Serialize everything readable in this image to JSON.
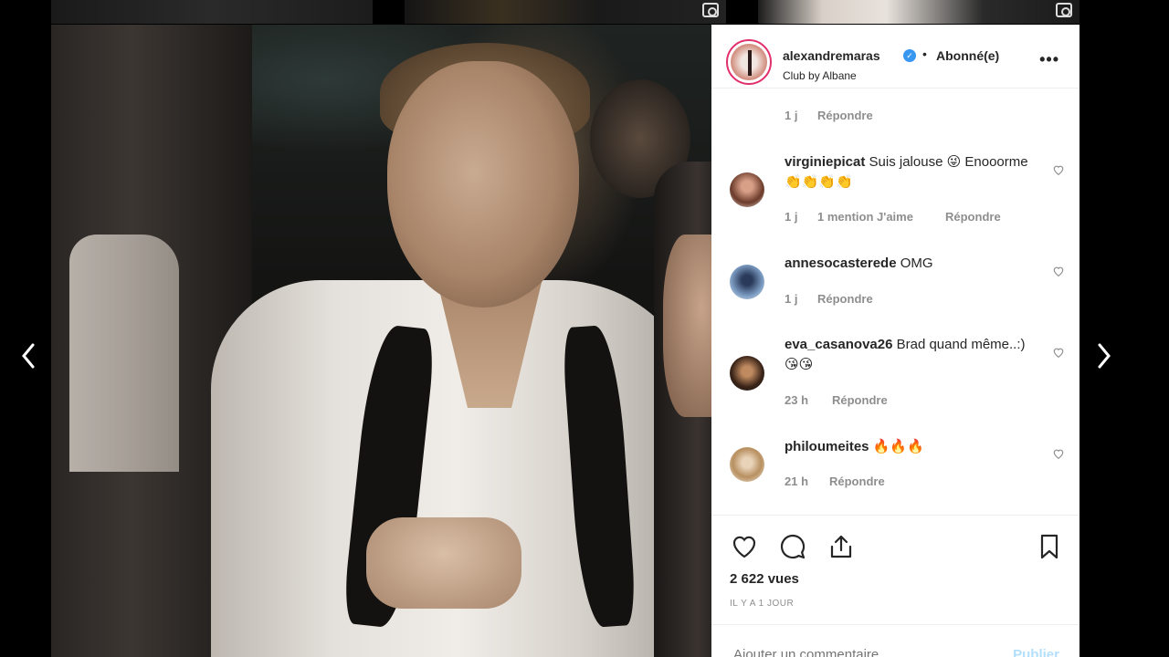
{
  "post": {
    "username": "alexandremaras",
    "follow_status": "Abonné(e)",
    "separator": "•",
    "location": "Club by Albane",
    "more": "•••"
  },
  "comments": [
    {
      "type": "meta-only",
      "time": "1 j",
      "reply": "Répondre"
    },
    {
      "username": "virginiepicat",
      "text": "Suis jalouse 😜 Enooorme👏👏👏👏",
      "time": "1 j",
      "likes": "1 mention J'aime",
      "reply": "Répondre"
    },
    {
      "username": "annesocasterede",
      "text": "OMG",
      "time": "1 j",
      "reply": "Répondre"
    },
    {
      "username": "eva_casanova26",
      "text": "Brad quand même..:) 😘😘",
      "time": "23 h",
      "reply": "Répondre"
    },
    {
      "username": "philoumeites",
      "text": "🔥🔥🔥",
      "time": "21 h",
      "reply": "Répondre"
    }
  ],
  "stats": {
    "views": "2 622 vues",
    "date": "IL Y A 1 JOUR"
  },
  "comment_box": {
    "placeholder": "Ajouter un commentaire…",
    "publish": "Publier"
  },
  "colors": {
    "accent": "#3897f0",
    "publish_disabled": "#b2dffc",
    "muted": "#8e8e8e"
  },
  "icons": [
    "camera-icon",
    "more-icon",
    "verified-icon",
    "heart-icon",
    "comment-icon",
    "share-icon",
    "bookmark-icon",
    "chevron-left-icon",
    "chevron-right-icon"
  ]
}
